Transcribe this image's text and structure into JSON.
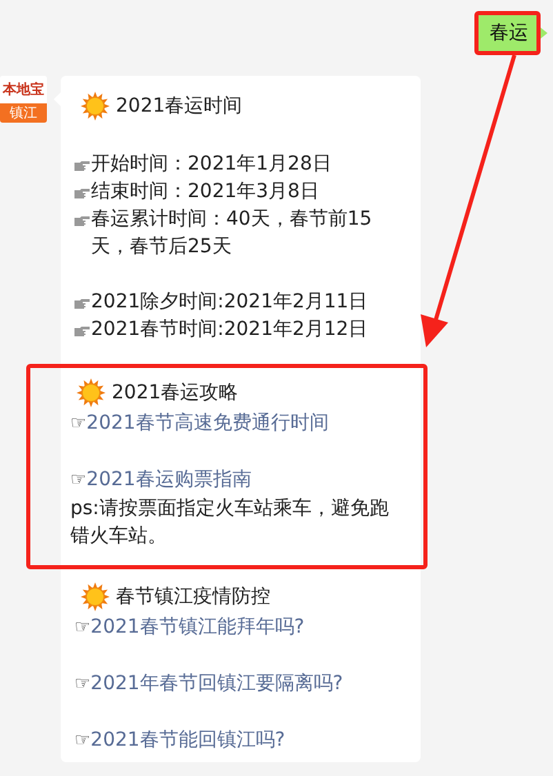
{
  "outgoing": {
    "text": "春运",
    "highlighted": true
  },
  "sender": {
    "avatar_brand": "本地宝",
    "avatar_city": "镇江"
  },
  "message": {
    "sections": [
      {
        "title": "2021春运时间",
        "highlighted": false,
        "items": [
          {
            "kind": "line",
            "text": "开始时间：2021年1月28日",
            "gap_before": true
          },
          {
            "kind": "line",
            "text": "结束时间：2021年3月8日",
            "gap_before": false
          },
          {
            "kind": "line",
            "text": "春运累计时间：40天，春节前15天，春节后25天",
            "gap_before": false
          },
          {
            "kind": "line",
            "text": "2021除夕时间:2021年2月11日",
            "gap_before": true
          },
          {
            "kind": "line",
            "text": "2021春节时间:2021年2月12日",
            "gap_before": false
          }
        ]
      },
      {
        "title": "2021春运攻略",
        "highlighted": true,
        "items": [
          {
            "kind": "link",
            "bullet": "☞",
            "text": "2021春节高速免费通行时间",
            "gap_before": false
          },
          {
            "kind": "link",
            "bullet": "☞",
            "text": "2021春运购票指南",
            "gap_before": true
          },
          {
            "kind": "note",
            "text": "ps:请按票面指定火车站乘车，避免跑错火车站。",
            "gap_before": false
          }
        ]
      },
      {
        "title": "春节镇江疫情防控",
        "highlighted": false,
        "items": [
          {
            "kind": "link",
            "bullet": "☞",
            "text": "2021春节镇江能拜年吗?",
            "gap_before": false
          },
          {
            "kind": "link",
            "bullet": "☞",
            "text": "2021年春节回镇江要隔离吗?",
            "gap_before": true
          },
          {
            "kind": "link",
            "bullet": "☞",
            "text": "2021春节能回镇江吗?",
            "gap_before": true
          }
        ]
      }
    ]
  }
}
